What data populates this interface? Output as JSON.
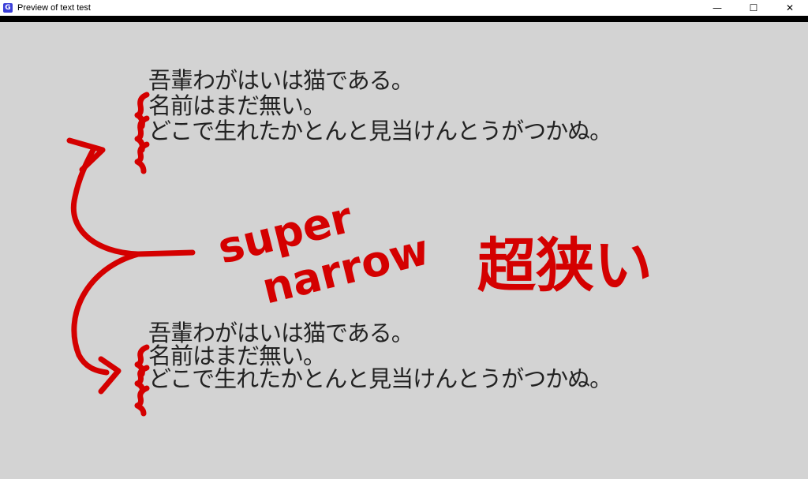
{
  "window": {
    "title": "Preview of text test",
    "icon": "app-icon",
    "controls": {
      "minimize": "—",
      "maximize": "☐",
      "close": "✕"
    }
  },
  "text_block_normal": {
    "lines": [
      "吾輩わがはいは猫である。",
      "名前はまだ無い。",
      "どこで生れたかとんと見当けんとうがつかぬ。"
    ]
  },
  "text_block_narrow": {
    "lines": [
      "吾輩わがはいは猫である。",
      "名前はまだ無い。",
      "どこで生れたかとんと見当けんとうがつかぬ。"
    ]
  },
  "annotation": {
    "english": "super narrow",
    "english_line1": "super",
    "english_line2": "narrow",
    "japanese": "超狭い",
    "color": "#d40000"
  }
}
